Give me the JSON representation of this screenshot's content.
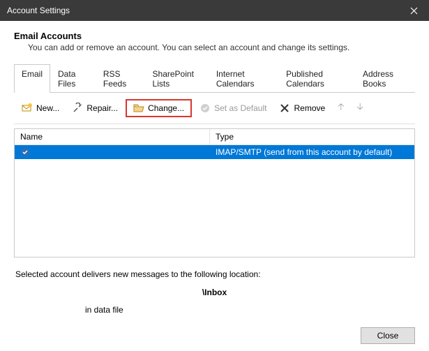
{
  "window": {
    "title": "Account Settings"
  },
  "header": {
    "title": "Email Accounts",
    "subtitle": "You can add or remove an account. You can select an account and change its settings."
  },
  "tabs": [
    {
      "label": "Email",
      "active": true
    },
    {
      "label": "Data Files"
    },
    {
      "label": "RSS Feeds"
    },
    {
      "label": "SharePoint Lists"
    },
    {
      "label": "Internet Calendars"
    },
    {
      "label": "Published Calendars"
    },
    {
      "label": "Address Books"
    }
  ],
  "toolbar": {
    "new": "New...",
    "repair": "Repair...",
    "change": "Change...",
    "set_default": "Set as Default",
    "remove": "Remove"
  },
  "list": {
    "columns": {
      "name": "Name",
      "type": "Type"
    },
    "rows": [
      {
        "name": "",
        "type": "IMAP/SMTP (send from this account by default)"
      }
    ]
  },
  "footer": {
    "delivers": "Selected account delivers new messages to the following location:",
    "location": "\\Inbox",
    "datafile": "in data file"
  },
  "buttons": {
    "close": "Close"
  }
}
